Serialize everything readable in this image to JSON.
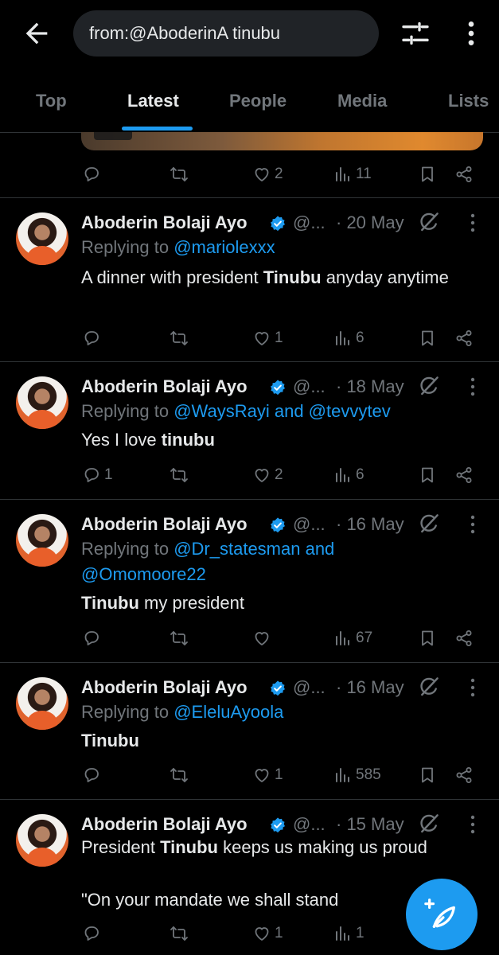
{
  "search": {
    "query": "from:@AboderinA tinubu"
  },
  "tabs": [
    "Top",
    "Latest",
    "People",
    "Media",
    "Lists"
  ],
  "active_tab": "Latest",
  "colors": {
    "accent": "#1d9bf0",
    "text": "#e7e9ea",
    "muted": "#71767b",
    "background": "#000000"
  },
  "first_tweet_actions": {
    "replies": "",
    "reposts": "",
    "likes": "2",
    "views": "11"
  },
  "tweets": [
    {
      "name": "Aboderin Bolaji Ayo",
      "handle": "@...",
      "date": "· 20 May",
      "reply_prefix": "Replying to",
      "mentions": [
        "@mariolexxx"
      ],
      "text_before": "A dinner with president ",
      "text_bold": "Tinubu",
      "text_after": " anyday anytime",
      "replies": "",
      "reposts": "",
      "likes": "1",
      "views": "6"
    },
    {
      "name": "Aboderin Bolaji Ayo",
      "handle": "@...",
      "date": "· 18 May",
      "reply_prefix": "Replying to",
      "mentions": [
        "@WaysRayi and @tevvytev"
      ],
      "text_before": "Yes I love ",
      "text_bold": "tinubu",
      "text_after": "",
      "replies": "1",
      "reposts": "",
      "likes": "2",
      "views": "6"
    },
    {
      "name": "Aboderin Bolaji Ayo",
      "handle": "@...",
      "date": "· 16 May",
      "reply_prefix": "Replying to",
      "mentions": [
        "@Dr_statesman and",
        "@Omomoore22"
      ],
      "text_before": "",
      "text_bold": "Tinubu",
      "text_after": " my president",
      "replies": "",
      "reposts": "",
      "likes": "",
      "views": "67"
    },
    {
      "name": "Aboderin Bolaji Ayo",
      "handle": "@...",
      "date": "· 16 May",
      "reply_prefix": "Replying to",
      "mentions": [
        "@EleluAyoola"
      ],
      "text_before": "",
      "text_bold": "Tinubu",
      "text_after": "",
      "replies": "",
      "reposts": "",
      "likes": "1",
      "views": "585"
    },
    {
      "name": "Aboderin Bolaji Ayo",
      "handle": "@...",
      "date": "· 15 May",
      "reply_prefix": "",
      "mentions": [],
      "text_before": "President ",
      "text_bold": "Tinubu",
      "text_after": " keeps us making us proud",
      "text_line2": "\"On your mandate we shall stand",
      "replies": "",
      "reposts": "",
      "likes": "1",
      "views": "1"
    }
  ],
  "icons": {
    "back": "arrow-left-icon",
    "filter": "sliders-icon",
    "more": "more-vertical-icon",
    "reply": "comment-icon",
    "repost": "repost-icon",
    "like": "heart-icon",
    "views": "analytics-icon",
    "bookmark": "bookmark-icon",
    "share": "share-icon",
    "grok": "grok-icon",
    "verified": "verified-badge-icon",
    "compose": "compose-feather-icon"
  }
}
